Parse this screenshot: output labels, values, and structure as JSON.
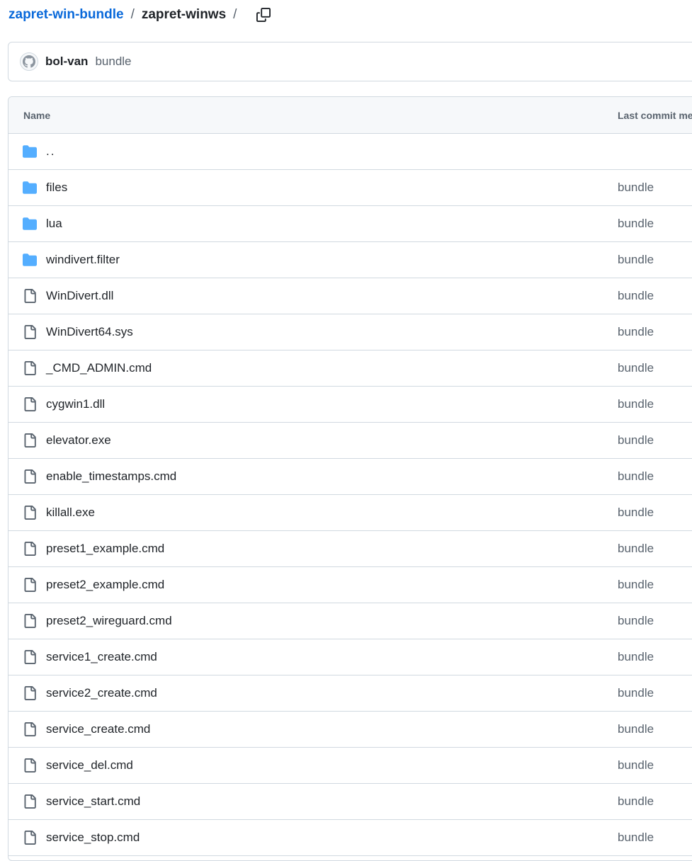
{
  "breadcrumb": {
    "repo": "zapret-win-bundle",
    "separator": "/",
    "current": "zapret-winws",
    "trailing_separator": "/"
  },
  "commit": {
    "author": "bol-van",
    "message": "bundle"
  },
  "table": {
    "header_name": "Name",
    "header_commit": "Last commit me",
    "parent": "..",
    "rows": [
      {
        "name": "files",
        "type": "folder",
        "commit": "bundle"
      },
      {
        "name": "lua",
        "type": "folder",
        "commit": "bundle"
      },
      {
        "name": "windivert.filter",
        "type": "folder",
        "commit": "bundle"
      },
      {
        "name": "WinDivert.dll",
        "type": "file",
        "commit": "bundle"
      },
      {
        "name": "WinDivert64.sys",
        "type": "file",
        "commit": "bundle"
      },
      {
        "name": "_CMD_ADMIN.cmd",
        "type": "file",
        "commit": "bundle"
      },
      {
        "name": "cygwin1.dll",
        "type": "file",
        "commit": "bundle"
      },
      {
        "name": "elevator.exe",
        "type": "file",
        "commit": "bundle"
      },
      {
        "name": "enable_timestamps.cmd",
        "type": "file",
        "commit": "bundle"
      },
      {
        "name": "killall.exe",
        "type": "file",
        "commit": "bundle"
      },
      {
        "name": "preset1_example.cmd",
        "type": "file",
        "commit": "bundle"
      },
      {
        "name": "preset2_example.cmd",
        "type": "file",
        "commit": "bundle"
      },
      {
        "name": "preset2_wireguard.cmd",
        "type": "file",
        "commit": "bundle"
      },
      {
        "name": "service1_create.cmd",
        "type": "file",
        "commit": "bundle"
      },
      {
        "name": "service2_create.cmd",
        "type": "file",
        "commit": "bundle"
      },
      {
        "name": "service_create.cmd",
        "type": "file",
        "commit": "bundle"
      },
      {
        "name": "service_del.cmd",
        "type": "file",
        "commit": "bundle"
      },
      {
        "name": "service_start.cmd",
        "type": "file",
        "commit": "bundle"
      },
      {
        "name": "service_stop.cmd",
        "type": "file",
        "commit": "bundle"
      }
    ]
  },
  "icons": {
    "folder": "folder-icon",
    "file": "file-icon",
    "copy": "copy-icon",
    "avatar": "github-avatar-icon"
  },
  "colors": {
    "link": "#0969da",
    "folder": "#54aeff",
    "muted": "#59636e",
    "border": "#d1d9e0"
  }
}
